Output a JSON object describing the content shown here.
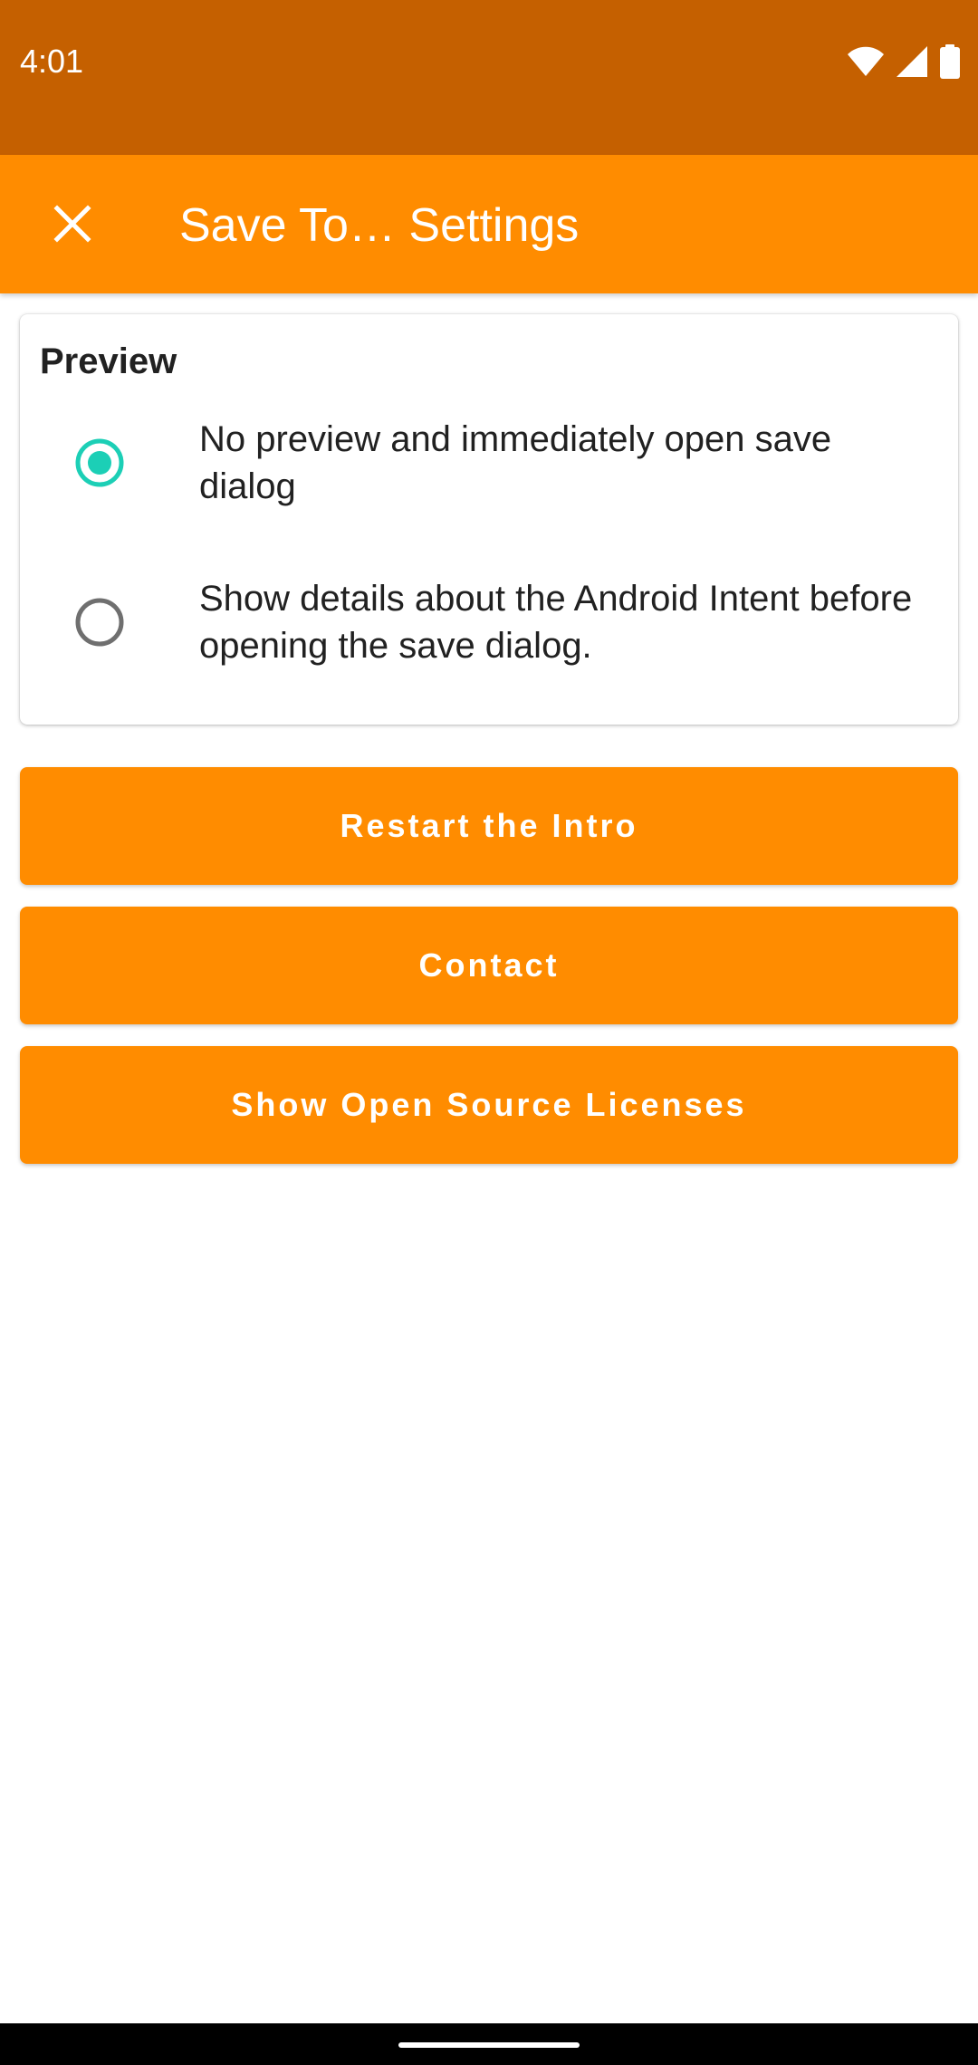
{
  "status_bar": {
    "time": "4:01",
    "icons": [
      "wifi-icon",
      "signal-icon",
      "battery-icon"
    ]
  },
  "app_bar": {
    "close_icon": "close-icon",
    "title": "Save To… Settings"
  },
  "preview_card": {
    "title": "Preview",
    "options": [
      {
        "label": "No preview and immediately open save dialog",
        "selected": true
      },
      {
        "label": "Show details about the Android Intent before opening the save dialog.",
        "selected": false
      }
    ]
  },
  "buttons": {
    "restart_intro": "Restart the Intro",
    "contact": "Contact",
    "licenses": "Show Open Source Licenses"
  },
  "colors": {
    "status_bar": "#c56000",
    "app_bar": "#ff8c00",
    "accent_radio": "#1ccfb6",
    "button": "#ff8c00"
  }
}
